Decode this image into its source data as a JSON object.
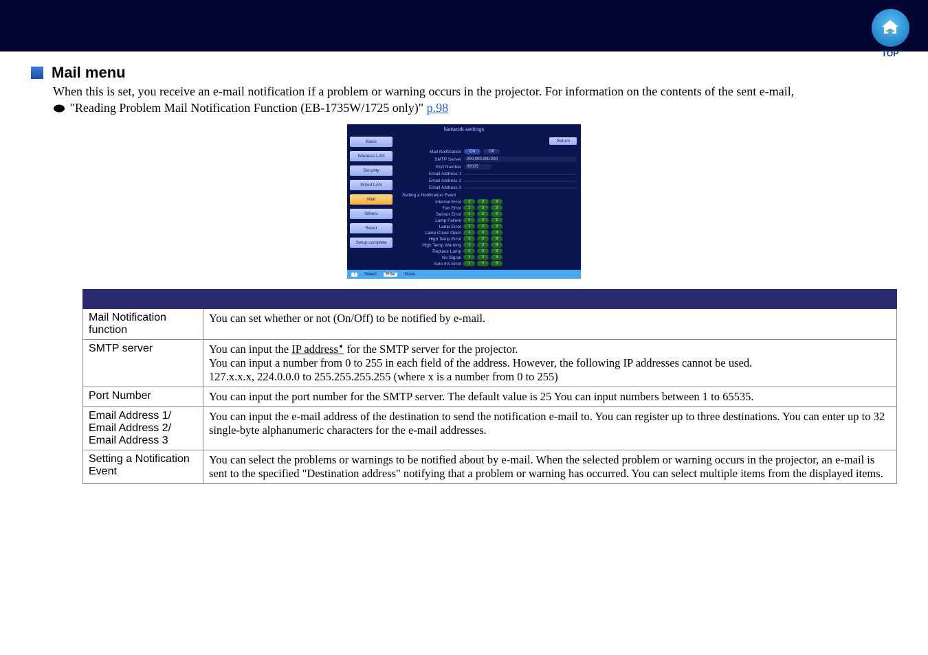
{
  "top": {
    "label": "TOP"
  },
  "heading": "Mail menu",
  "intro_line1": "When this is set, you receive an e-mail notification if a problem or warning occurs in the projector. For information on the contents of the sent e-mail,",
  "intro_line2a": "\"Reading Problem Mail Notification Function (EB-1735W/1725 only)\" ",
  "intro_link": "p.98",
  "screenshot": {
    "title": "Network settings",
    "side": {
      "basic": "Basic",
      "wlan": "Wireless LAN",
      "security": "Security",
      "wired": "Wired LAN",
      "mail": "Mail",
      "others": "Others",
      "reset": "Reset",
      "complete": "Setup complete"
    },
    "return": "Return",
    "labels": {
      "mailnotif": "Mail Notification",
      "smtp": "SMTP Server",
      "port": "Port Number",
      "e1": "Email Address 1",
      "e2": "Email Address 2",
      "e3": "Email Address 3",
      "section": "Setting a Notification Event",
      "ev": {
        "internal": "Internal Error",
        "fan": "Fan Error",
        "sensor": "Sensor Error",
        "lampfail": "Lamp Failure",
        "lamperr": "Lamp Error",
        "cover": "Lamp Cover Open",
        "hterr": "High Temp Error",
        "htwarn": "High Temp Warning",
        "replace": "Replace Lamp",
        "nosig": "No Signal",
        "iris": "Auto Iris Error"
      }
    },
    "on": "On",
    "off": "Off",
    "ip": "000.000.000.000",
    "portv": "00025",
    "c1": "1",
    "c2": "2",
    "c3": "3",
    "footer": {
      "sel": "Select",
      "done": "Done",
      "selk": "↕",
      "donek": "Enter"
    }
  },
  "table": {
    "rows": [
      {
        "label": "Mail Notification function",
        "desc": "You can set whether or not (On/Off) to be notified by e-mail."
      },
      {
        "label": "SMTP server",
        "desc_pre": "You can input the ",
        "glossary": "IP address",
        "desc_post": " for the SMTP server for the projector.",
        "desc2": "You can input a number from 0 to 255 in each field of the address. However, the following IP addresses cannot be used.",
        "desc3": "127.x.x.x, 224.0.0.0 to 255.255.255.255 (where x is a number from 0 to 255)"
      },
      {
        "label": "Port Number",
        "desc": "You can input the port number for the SMTP server. The default value is 25 You can input numbers between 1 to 65535."
      },
      {
        "label": "Email Address 1/\nEmail Address 2/\nEmail Address 3",
        "desc": "You can input the e-mail address of the destination to send the notification e-mail to. You can register up to three destinations. You can enter up to 32 single-byte alphanumeric characters for the e-mail addresses."
      },
      {
        "label": "Setting a Notification Event",
        "desc": "You can select the problems or warnings to be notified about by e-mail. When the selected problem or warning occurs in the projector, an e-mail is sent to the specified \"Destination address\" notifying that a problem or warning has occurred. You can select multiple items from the displayed items."
      }
    ]
  }
}
